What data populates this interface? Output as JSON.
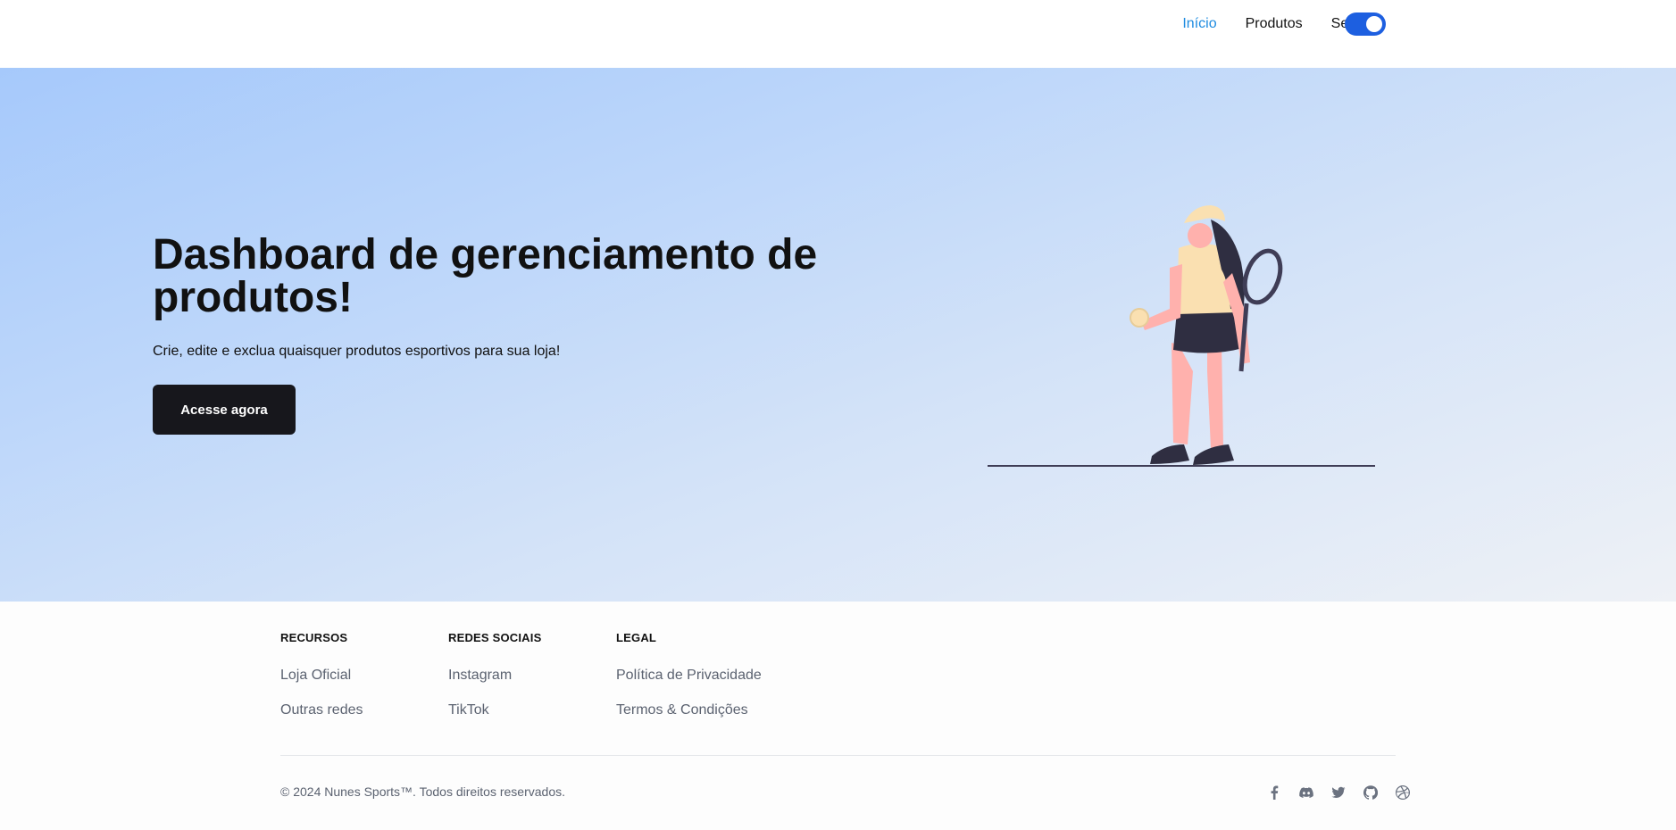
{
  "nav": {
    "links": [
      "Início",
      "Produtos",
      "Serviços"
    ],
    "active": "Início",
    "theme_toggle": "on"
  },
  "hero": {
    "title": "Dashboard de gerenciamento de produtos!",
    "subtitle": "Crie, edite e exclua quaisquer produtos esportivos para sua loja!",
    "cta_label": "Acesse agora",
    "illustration": "woman-tennis-player-illustration"
  },
  "footer": {
    "columns": [
      {
        "heading": "RECURSOS",
        "links": [
          "Loja Oficial",
          "Outras redes"
        ]
      },
      {
        "heading": "REDES SOCIAIS",
        "links": [
          "Instagram",
          "TikTok"
        ]
      },
      {
        "heading": "LEGAL",
        "links": [
          "Política de Privacidade",
          "Termos & Condições"
        ]
      }
    ],
    "copyright": "© 2024 Nunes Sports™. Todos direitos reservados.",
    "social_icons": [
      "facebook-icon",
      "discord-icon",
      "twitter-icon",
      "github-icon",
      "dribbble-icon"
    ]
  },
  "colors": {
    "accent": "#1d8be0",
    "toggle": "#1d5fe0",
    "button_bg": "#17171c",
    "hero_gradient_start": "#a6c9fb",
    "hero_gradient_end": "#eef1f6"
  }
}
